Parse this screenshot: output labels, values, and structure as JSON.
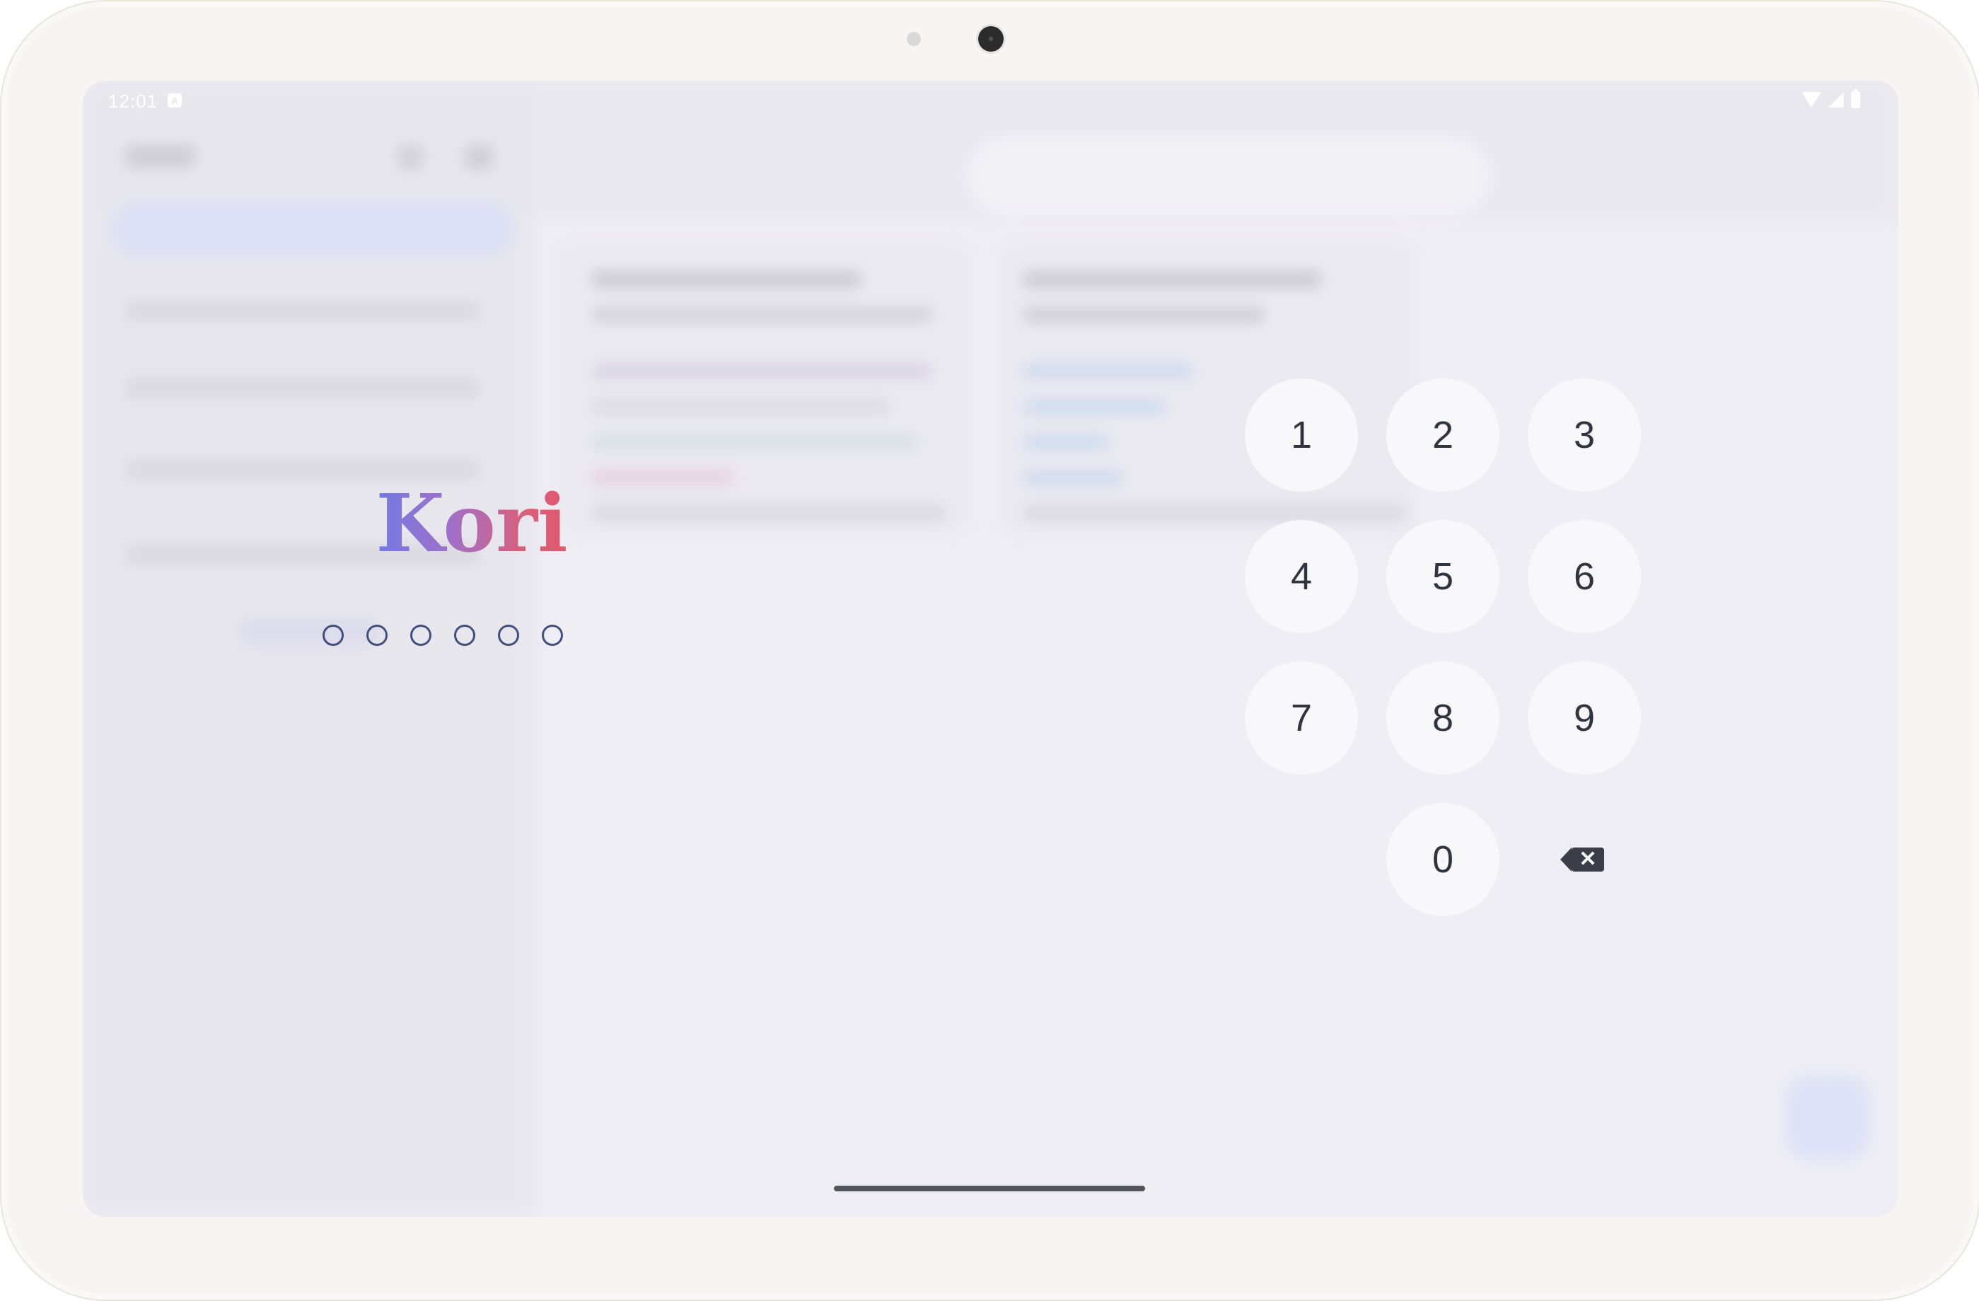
{
  "status_bar": {
    "time": "12:01",
    "notification_icon": "A",
    "icons": [
      "wifi-icon",
      "signal-icon",
      "battery-icon"
    ]
  },
  "lock": {
    "app_name": "Kori",
    "pin_length": 6,
    "pin_entered": 0
  },
  "keypad": {
    "keys": [
      "1",
      "2",
      "3",
      "4",
      "5",
      "6",
      "7",
      "8",
      "9",
      "0"
    ],
    "backspace_icon": "backspace-icon"
  },
  "colors": {
    "logo_gradient_start": "#6b7be6",
    "logo_gradient_end": "#e0566a",
    "pin_dot": "#41507e",
    "key_bg": "#f8f8fa",
    "key_text": "#2f3440"
  }
}
